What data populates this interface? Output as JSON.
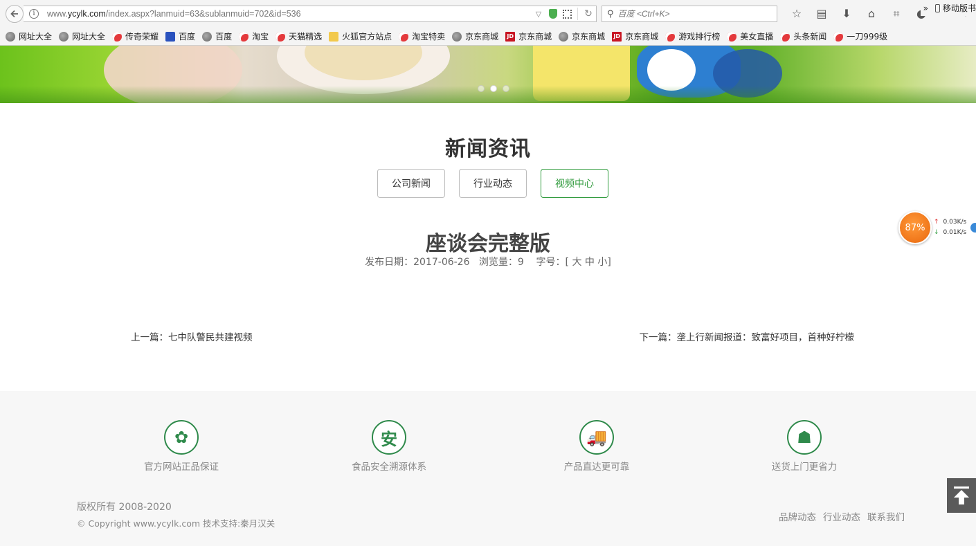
{
  "browser": {
    "url_prefix": "www.",
    "url_domain": "ycylk.com",
    "url_path": "/index.aspx?lanmuid=63&sublanmuid=702&id=536",
    "search_placeholder": "百度 <Ctrl+K>",
    "bookmarks": [
      {
        "label": "网址大全",
        "icon": "globe"
      },
      {
        "label": "网址大全",
        "icon": "globe"
      },
      {
        "label": "传奇荣耀",
        "icon": "swirl"
      },
      {
        "label": "百度",
        "icon": "paw"
      },
      {
        "label": "百度",
        "icon": "globe"
      },
      {
        "label": "淘宝",
        "icon": "swirl"
      },
      {
        "label": "天猫精选",
        "icon": "swirl"
      },
      {
        "label": "火狐官方站点",
        "icon": "folder"
      },
      {
        "label": "淘宝特卖",
        "icon": "swirl"
      },
      {
        "label": "京东商城",
        "icon": "globe"
      },
      {
        "label": "京东商城",
        "icon": "jd"
      },
      {
        "label": "京东商城",
        "icon": "globe"
      },
      {
        "label": "京东商城",
        "icon": "jd"
      },
      {
        "label": "游戏排行榜",
        "icon": "swirl"
      },
      {
        "label": "美女直播",
        "icon": "swirl"
      },
      {
        "label": "头条新闻",
        "icon": "swirl"
      },
      {
        "label": "一刀999级",
        "icon": "swirl"
      }
    ],
    "bookmarks_overflow": "移动版书"
  },
  "banner": {
    "slide_count": 3,
    "active_slide": 2
  },
  "section": {
    "title": "新闻资讯",
    "tabs": [
      {
        "label": "公司新闻",
        "active": false
      },
      {
        "label": "行业动态",
        "active": false
      },
      {
        "label": "视频中心",
        "active": true
      }
    ]
  },
  "article": {
    "title": "座谈会完整版",
    "meta": "发布日期：2017-06-26   浏览量：9    字号：[ 大 中 小]",
    "prev": "上一篇：七中队警民共建视频",
    "next": "下一篇：垄上行新闻报道：致富好项目，首种好柠檬"
  },
  "footer": {
    "features": [
      {
        "label": "官方网站正品保证",
        "icon": "leaf-logo-icon",
        "glyph": "✿"
      },
      {
        "label": "食品安全溯源体系",
        "icon": "safety-an-icon",
        "glyph": "安"
      },
      {
        "label": "产品直达更可靠",
        "icon": "truck-icon",
        "glyph": "🚚"
      },
      {
        "label": "送货上门更省力",
        "icon": "delivery-man-icon",
        "glyph": "☗"
      }
    ],
    "copyright_line1": "版权所有 2008-2020",
    "copyright_line2": "© Copyright www.ycylk.com 技术支持:秦月汉关",
    "links": [
      "品牌动态",
      "行业动态",
      "联系我们"
    ]
  },
  "speed_widget": {
    "percent": "87%",
    "upload": "0.03K/s",
    "download": "0.01K/s"
  },
  "colors": {
    "accent_green": "#2e9a3b",
    "footer_icon": "#2f8a4b",
    "footer_bg": "#f7f7f7"
  }
}
